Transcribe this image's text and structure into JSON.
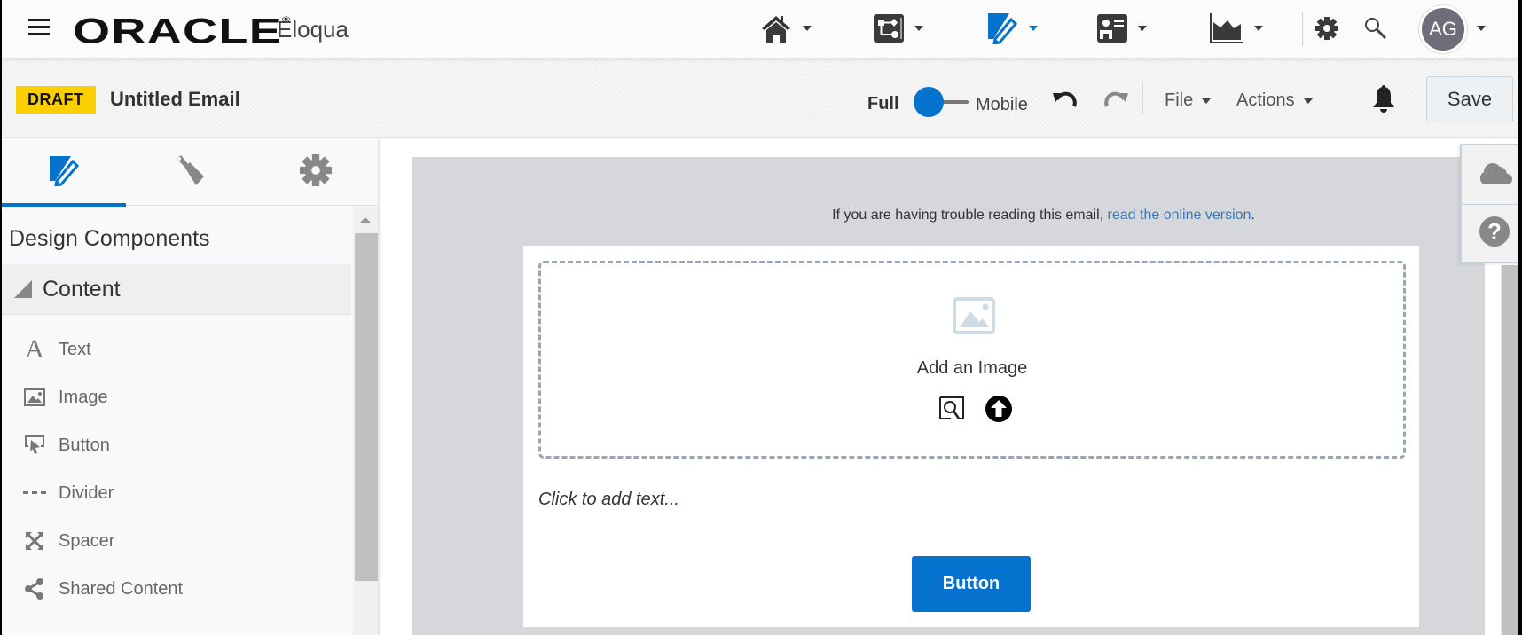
{
  "topnav": {
    "brand": "ORACLE",
    "brand_mark": "®",
    "product": "Eloqua",
    "menu_icon": "hamburger-icon",
    "nav_items": [
      {
        "icon": "home-icon",
        "active": false
      },
      {
        "icon": "orchestration-icon",
        "active": false
      },
      {
        "icon": "assets-edit-icon",
        "active": true
      },
      {
        "icon": "contacts-icon",
        "active": false
      },
      {
        "icon": "analytics-icon",
        "active": false
      }
    ],
    "settings_icon": "gear-icon",
    "search_icon": "search-icon",
    "user_initials": "AG",
    "accent_color": "#0572ce"
  },
  "toolbar": {
    "status_badge": "DRAFT",
    "status_color": "#fcd000",
    "title": "Untitled Email",
    "view_full": "Full",
    "view_mobile": "Mobile",
    "view_selected": "Full",
    "undo_icon": "undo-icon",
    "redo_icon": "redo-icon",
    "file_menu": "File",
    "actions_menu": "Actions",
    "notifications_icon": "bell-icon",
    "save_label": "Save"
  },
  "left_panel": {
    "tabs": [
      {
        "icon": "design-edit-icon",
        "active": true
      },
      {
        "icon": "paintbrush-icon",
        "active": false
      },
      {
        "icon": "gear-icon",
        "active": false
      }
    ],
    "section_title": "Design Components",
    "group": {
      "label": "Content",
      "expanded": true,
      "items": [
        {
          "label": "Text",
          "icon": "text-icon"
        },
        {
          "label": "Image",
          "icon": "image-icon"
        },
        {
          "label": "Button",
          "icon": "button-cursor-icon"
        },
        {
          "label": "Divider",
          "icon": "divider-icon"
        },
        {
          "label": "Spacer",
          "icon": "spacer-icon"
        },
        {
          "label": "Shared Content",
          "icon": "share-icon"
        }
      ]
    }
  },
  "canvas": {
    "trouble_text": "If you are having trouble reading this email, ",
    "online_link": "read the online version",
    "trouble_suffix": ".",
    "image_block": {
      "label": "Add an Image",
      "browse_icon": "image-search-icon",
      "upload_icon": "upload-icon"
    },
    "text_placeholder": "Click to add text...",
    "button_label": "Button",
    "button_color": "#0572ce",
    "side_tools": [
      "cloud-icon",
      "help-icon"
    ]
  }
}
